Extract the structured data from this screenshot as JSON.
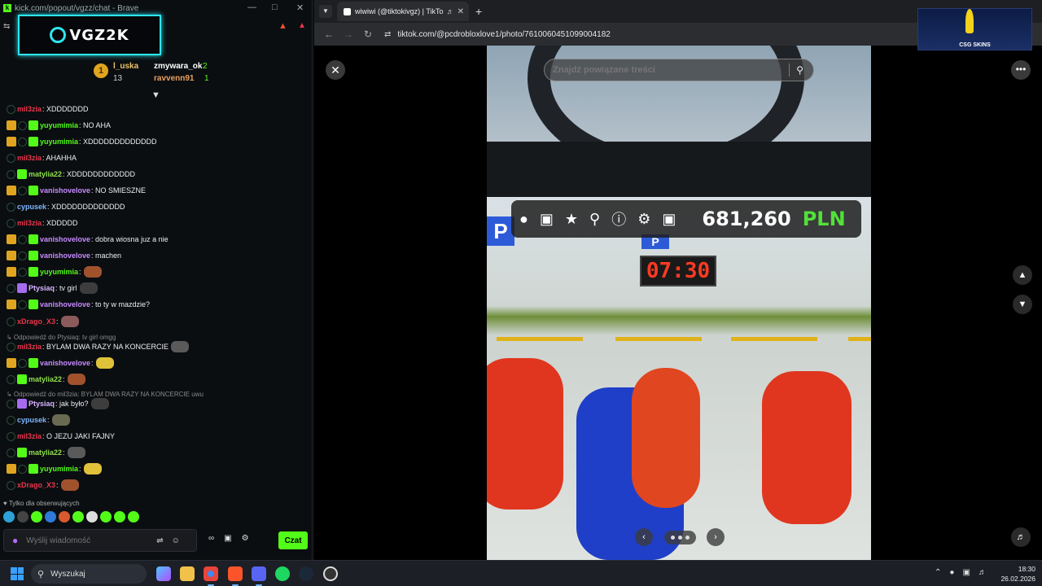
{
  "chat_window": {
    "title": "kick.com/popout/vgzz/chat - Brave",
    "overlay_logo": "VGZ2K",
    "leaderboard": {
      "rank": "1",
      "first": {
        "name": "l_uska",
        "count": "13"
      },
      "second": {
        "name": "zmywara_ok",
        "count": "2"
      },
      "third": {
        "name": "ravvenn91",
        "count": "1"
      }
    },
    "messages": [
      {
        "user": "mil3zia",
        "color": "#e8364a",
        "badges": [
          "ring"
        ],
        "text": ": XDDDDDDD"
      },
      {
        "user": "yuyumimia",
        "color": "#53fc18",
        "badges": [
          "crown",
          "ring",
          "green"
        ],
        "text": ": NO AHA"
      },
      {
        "user": "yuyumimia",
        "color": "#53fc18",
        "badges": [
          "crown",
          "ring",
          "green"
        ],
        "text": ": XDDDDDDDDDDDDD"
      },
      {
        "user": "mil3zia",
        "color": "#e8364a",
        "badges": [
          "ring"
        ],
        "text": ": AHAHHA"
      },
      {
        "user": "matylia22",
        "color": "#8fe04a",
        "badges": [
          "ring",
          "green"
        ],
        "text": ": XDDDDDDDDDDDD"
      },
      {
        "user": "vanishovelove",
        "color": "#c78bff",
        "badges": [
          "crown",
          "ring",
          "green"
        ],
        "text": ": NO SMIESZNE"
      },
      {
        "user": "cypusek",
        "color": "#7fb7ff",
        "badges": [
          "ring"
        ],
        "text": ": XDDDDDDDDDDDDD"
      },
      {
        "user": "mil3zia",
        "color": "#e8364a",
        "badges": [
          "ring"
        ],
        "text": ": XDDDDD"
      },
      {
        "user": "vanishovelove",
        "color": "#c78bff",
        "badges": [
          "crown",
          "ring",
          "green"
        ],
        "text": ": dobra wiosna juz a nie"
      },
      {
        "user": "vanishovelove",
        "color": "#c78bff",
        "badges": [
          "crown",
          "ring",
          "green"
        ],
        "text": ": machen"
      },
      {
        "user": "yuyumimia",
        "color": "#53fc18",
        "badges": [
          "crown",
          "ring",
          "green"
        ],
        "text": ":",
        "emote": true
      },
      {
        "user": "Ptysiaq",
        "color": "#d8b4ff",
        "badges": [
          "ring",
          "purple"
        ],
        "text": ": tv girl",
        "emote": true
      },
      {
        "user": "vanishovelove",
        "color": "#c78bff",
        "badges": [
          "crown",
          "ring",
          "green"
        ],
        "text": ": to ty w mazdzie?"
      },
      {
        "user": "xDrago_X3",
        "color": "#e8364a",
        "badges": [
          "ring"
        ],
        "text": ":",
        "emote": true
      },
      {
        "user": "mil3zia",
        "color": "#e8364a",
        "badges": [
          "ring"
        ],
        "text": ": BYLAM DWA RAZY NA KONCERCIE",
        "emote": true
      },
      {
        "user": "vanishovelove",
        "color": "#c78bff",
        "badges": [
          "crown",
          "ring",
          "green"
        ],
        "text": ":",
        "emote": true
      },
      {
        "user": "matylia22",
        "color": "#8fe04a",
        "badges": [
          "ring",
          "green"
        ],
        "text": ":",
        "emote": true
      },
      {
        "user": "Ptysiaq",
        "color": "#d8b4ff",
        "badges": [
          "ring",
          "purple"
        ],
        "text": ": jak było?",
        "emote": true
      },
      {
        "user": "cypusek",
        "color": "#7fb7ff",
        "badges": [
          "ring"
        ],
        "text": ":",
        "emote": true
      },
      {
        "user": "mil3zia",
        "color": "#e8364a",
        "badges": [
          "ring"
        ],
        "text": ": O JEZU JAKI FAJNY"
      },
      {
        "user": "matylia22",
        "color": "#8fe04a",
        "badges": [
          "ring",
          "green"
        ],
        "text": ":",
        "emote": true
      },
      {
        "user": "yuyumimia",
        "color": "#53fc18",
        "badges": [
          "crown",
          "ring",
          "green"
        ],
        "text": ":",
        "emote": true
      },
      {
        "user": "xDrago_X3",
        "color": "#e8364a",
        "badges": [
          "ring"
        ],
        "text": ":",
        "emote": true
      }
    ],
    "replies": [
      {
        "text": "Odpowiedź do Ptysiaq: tv girl omgg"
      },
      {
        "text": "Odpowiedź do mil3zia: BYLAM DWA RAZY NA KONCERCIE uwu"
      }
    ],
    "followers_only": "Tylko dla obserwujących",
    "input_placeholder": "Wyślij wiadomość",
    "send_label": "Czat"
  },
  "browser": {
    "tab_title": "wiwiwi (@tiktokivgz) | TikTo",
    "url": "tiktok.com/@pcdrobloxlove1/photo/7610060451099004182",
    "ad_text": "CSG SKINS",
    "search_placeholder": "Znajdź powiązane treści",
    "game": {
      "money": "681,260",
      "currency": "PLN",
      "timer": "07:30"
    }
  },
  "taskbar": {
    "search_label": "Wyszukaj",
    "time": "18:30",
    "date": "26.02.2026"
  },
  "colors": {
    "kick_green": "#53fc18",
    "accent_cyan": "#2ee6f0"
  }
}
